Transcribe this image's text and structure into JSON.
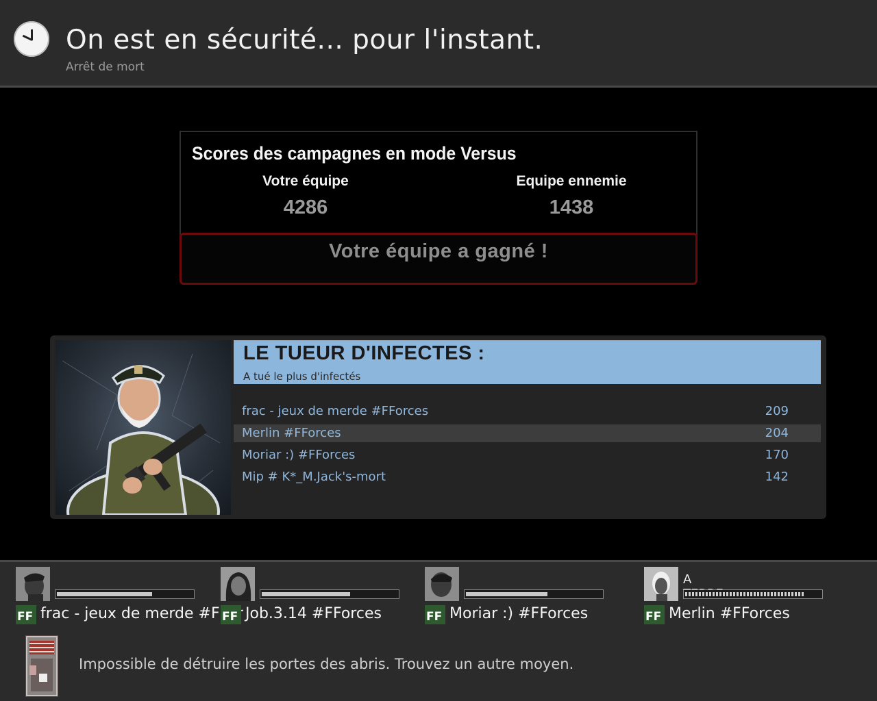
{
  "header": {
    "title": "On est en sécurité... pour l'instant.",
    "subtitle": "Arrêt de mort",
    "icon": "clock-icon"
  },
  "scores": {
    "title": "Scores des campagnes en mode Versus",
    "your_team_label": "Votre équipe",
    "your_team_score": "4286",
    "enemy_team_label": "Equipe ennemie",
    "enemy_team_score": "1438",
    "result": "Votre équipe a gagné !"
  },
  "award": {
    "title": "LE TUEUR D'INFECTES :",
    "subtitle": "A tué le plus d'infectés",
    "rows": [
      {
        "name": "frac - jeux de merde #FForces",
        "value": "209",
        "highlighted": false
      },
      {
        "name": "Merlin #FForces",
        "value": "204",
        "highlighted": true
      },
      {
        "name": "Moriar :) #FForces",
        "value": "170",
        "highlighted": false
      },
      {
        "name": "Mip # K*_M.Jack's-mort",
        "value": "142",
        "highlighted": false
      }
    ]
  },
  "players": [
    {
      "name": "frac - jeux de merde #FForces",
      "health_fraction": 0.7,
      "status": ""
    },
    {
      "name": "Job.3.14 #FForces",
      "health_fraction": 0.65,
      "status": ""
    },
    {
      "name": "Moriar :) #FForces",
      "health_fraction": 0.6,
      "status": ""
    },
    {
      "name": "Merlin #FForces",
      "health_fraction": 0.88,
      "status": "A TERRE"
    }
  ],
  "tip": {
    "text": "Impossible de détruire les portes des abris. Trouvez un autre moyen.",
    "icon": "safe-room-door-icon"
  },
  "colors": {
    "award_header": "#8db6dc",
    "leaderboard_text": "#8fb7de",
    "result_border": "#6a0a0a"
  }
}
